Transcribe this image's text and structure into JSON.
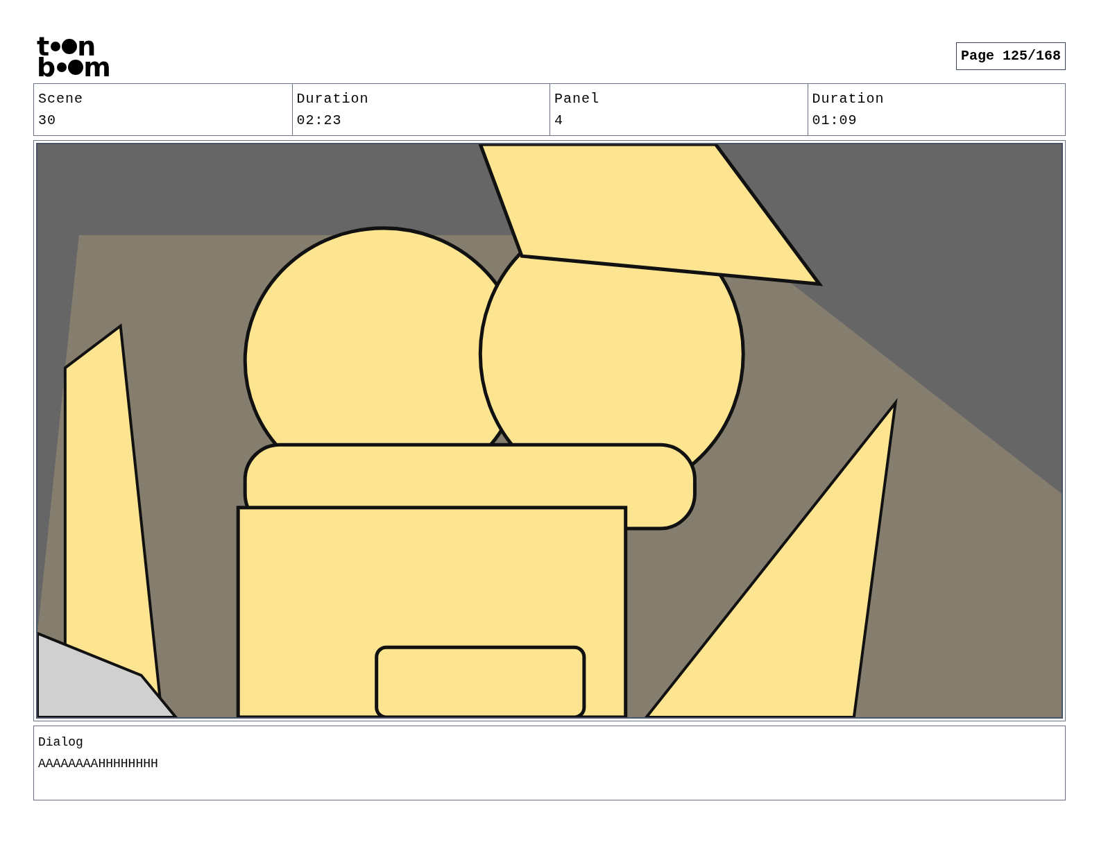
{
  "logo": {
    "top": [
      "t",
      "n"
    ],
    "bottom": [
      "b",
      "m"
    ]
  },
  "page": "Page 125/168",
  "fields": [
    {
      "label": "Scene",
      "value": "30"
    },
    {
      "label": "Duration",
      "value": "02:23"
    },
    {
      "label": "Panel",
      "value": "4"
    },
    {
      "label": "Duration",
      "value": "01:09"
    }
  ],
  "dialog": {
    "label": "Dialog",
    "text": "AAAAAAAAHHHHHHHH"
  }
}
